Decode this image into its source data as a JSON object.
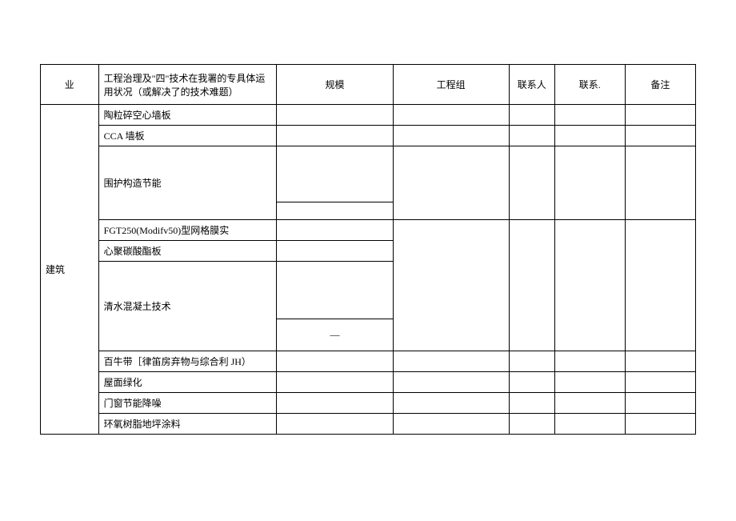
{
  "headers": {
    "ye": "业",
    "tech": "工程治理及\"四\"技术在我署的专具体运用状况（或解决了的技术难题）",
    "scale": "规模",
    "group": "工程组",
    "contact": "联系人",
    "phone": "联系.",
    "note": "备注"
  },
  "category": "建筑",
  "rows": {
    "r1": "陶粒碎空心墙板",
    "r2": "CCA 墙板",
    "r3": "围护构造节能",
    "r4": "FGT250(Modifv50)型网格膜实",
    "r5": "心聚碳酸酯板",
    "r6": "清水混凝土技术",
    "r6_dash": "—",
    "r7": "百牛带［律笛房弃物与综合利 JH）",
    "r8": "屋面绿化",
    "r9": "门窗节能降噪",
    "r10": "环氧树脂地坪涂料"
  }
}
